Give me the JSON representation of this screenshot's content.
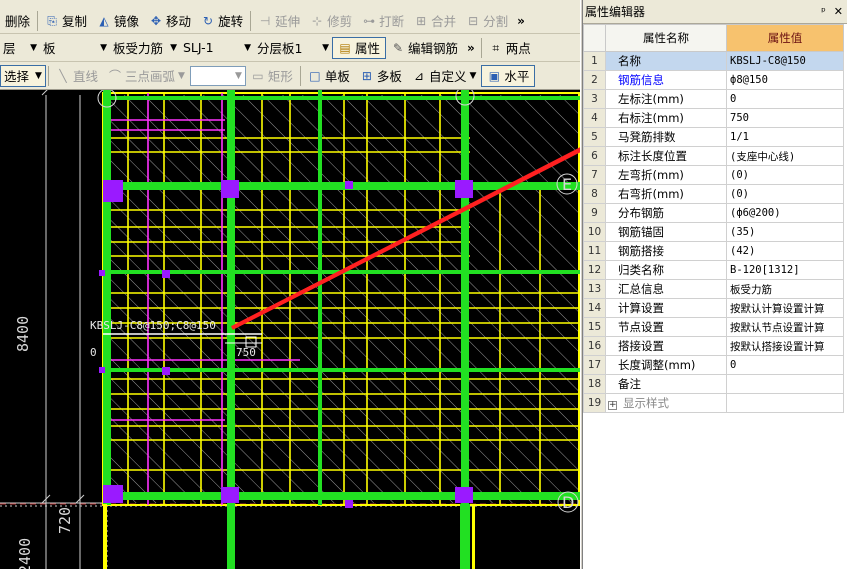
{
  "toolbar1": {
    "delete": "删除",
    "copy": "复制",
    "mirror": "镜像",
    "move": "移动",
    "rotate": "旋转",
    "extend": "延伸",
    "trim": "修剪",
    "break": "打断",
    "merge": "合并",
    "split": "分割",
    "more": "»"
  },
  "toolbar2": {
    "floor": "层",
    "category": "板",
    "element_type": "板受力筋",
    "element_name": "SLJ-1",
    "layer": "分层板1",
    "property": "属性",
    "edit_rebar": "编辑钢筋",
    "more": "»",
    "two_points": "两点"
  },
  "toolbar3": {
    "select": "选择",
    "line": "直线",
    "arc": "三点画弧",
    "rect": "矩形",
    "single_board": "单板",
    "multi_board": "多板",
    "custom": "自定义",
    "horizontal": "水平"
  },
  "canvas": {
    "dims": [
      "8400",
      "720",
      "2400"
    ],
    "axis_labels": [
      "E",
      "D"
    ],
    "rebar_label": "KBSLJ-C8@150;C8@150",
    "rebar_zero": "0",
    "rebar_len": "750"
  },
  "panel": {
    "title": "属性编辑器",
    "pin": "ᵖ",
    "close": "✕",
    "col_name": "属性名称",
    "col_value": "属性值",
    "rows": [
      {
        "n": "1",
        "name": "名称",
        "value": "KBSLJ-C8@150"
      },
      {
        "n": "2",
        "name": "钢筋信息",
        "value": "ф8@150"
      },
      {
        "n": "3",
        "name": "左标注(mm)",
        "value": "0"
      },
      {
        "n": "4",
        "name": "右标注(mm)",
        "value": "750"
      },
      {
        "n": "5",
        "name": "马凳筋排数",
        "value": "1/1"
      },
      {
        "n": "6",
        "name": "标注长度位置",
        "value": "(支座中心线)"
      },
      {
        "n": "7",
        "name": "左弯折(mm)",
        "value": "(0)"
      },
      {
        "n": "8",
        "name": "右弯折(mm)",
        "value": "(0)"
      },
      {
        "n": "9",
        "name": "分布钢筋",
        "value": "(ф6@200)"
      },
      {
        "n": "10",
        "name": "钢筋锚固",
        "value": "(35)"
      },
      {
        "n": "11",
        "name": "钢筋搭接",
        "value": "(42)"
      },
      {
        "n": "12",
        "name": "归类名称",
        "value": "B-120[1312]"
      },
      {
        "n": "13",
        "name": "汇总信息",
        "value": "板受力筋"
      },
      {
        "n": "14",
        "name": "计算设置",
        "value": "按默认计算设置计算"
      },
      {
        "n": "15",
        "name": "节点设置",
        "value": "按默认节点设置计算"
      },
      {
        "n": "16",
        "name": "搭接设置",
        "value": "按默认搭接设置计算"
      },
      {
        "n": "17",
        "name": "长度调整(mm)",
        "value": "0"
      },
      {
        "n": "18",
        "name": "备注",
        "value": ""
      },
      {
        "n": "19",
        "name": "显示样式",
        "value": "",
        "expand": "+"
      }
    ]
  },
  "colors": {
    "beam": "#22e022",
    "rebar_yellow": "#ffff00",
    "rebar_magenta": "#ff33ff",
    "arrow": "#ff2020",
    "header_value_bg": "#f7c26e",
    "selection": "#c3d7ee"
  }
}
